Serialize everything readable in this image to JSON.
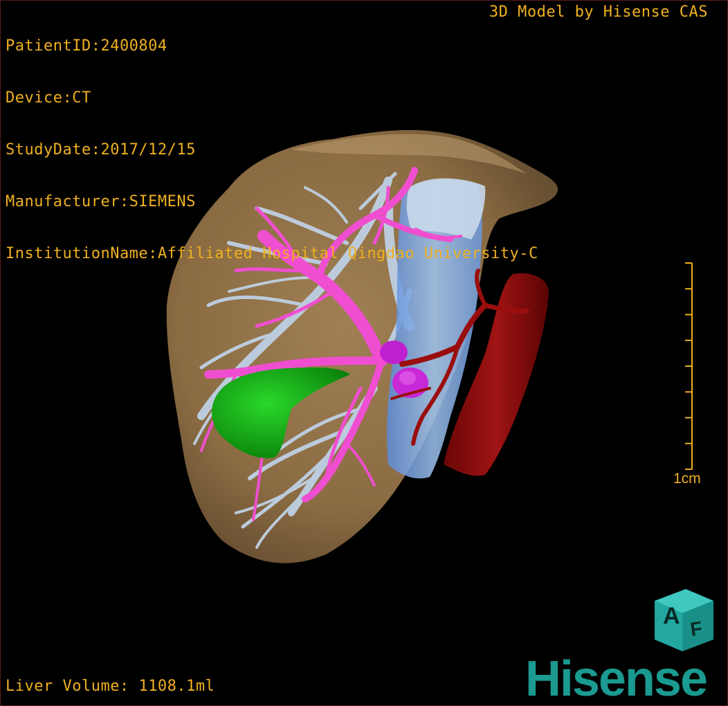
{
  "patient": {
    "patient_id": "PatientID:2400804",
    "device": "Device:CT",
    "study_date": "StudyDate:2017/12/15",
    "manufacturer": "Manufacturer:SIEMENS",
    "institution": "InstitutionName:Affiliated Hospital Qingdao University-C"
  },
  "credit": "3D Model by Hisense CAS",
  "liver_volume": "Liver Volume: 1108.1ml",
  "scale": {
    "label": "1cm",
    "ticks": 8
  },
  "logo": {
    "cube_letters": [
      "A",
      "F"
    ],
    "brand": "Hisense"
  },
  "colors": {
    "overlay_text": "#f0b020",
    "liver": "#9c7a4e",
    "portal_vein": "#f04ed0",
    "hepatic_vein": "#b8c8dc",
    "ivc": "#8ab4e8",
    "artery": "#8a0c0c",
    "gallbladder": "#14a014",
    "tumor": "#c020d0",
    "brand": "#1a9a90"
  }
}
